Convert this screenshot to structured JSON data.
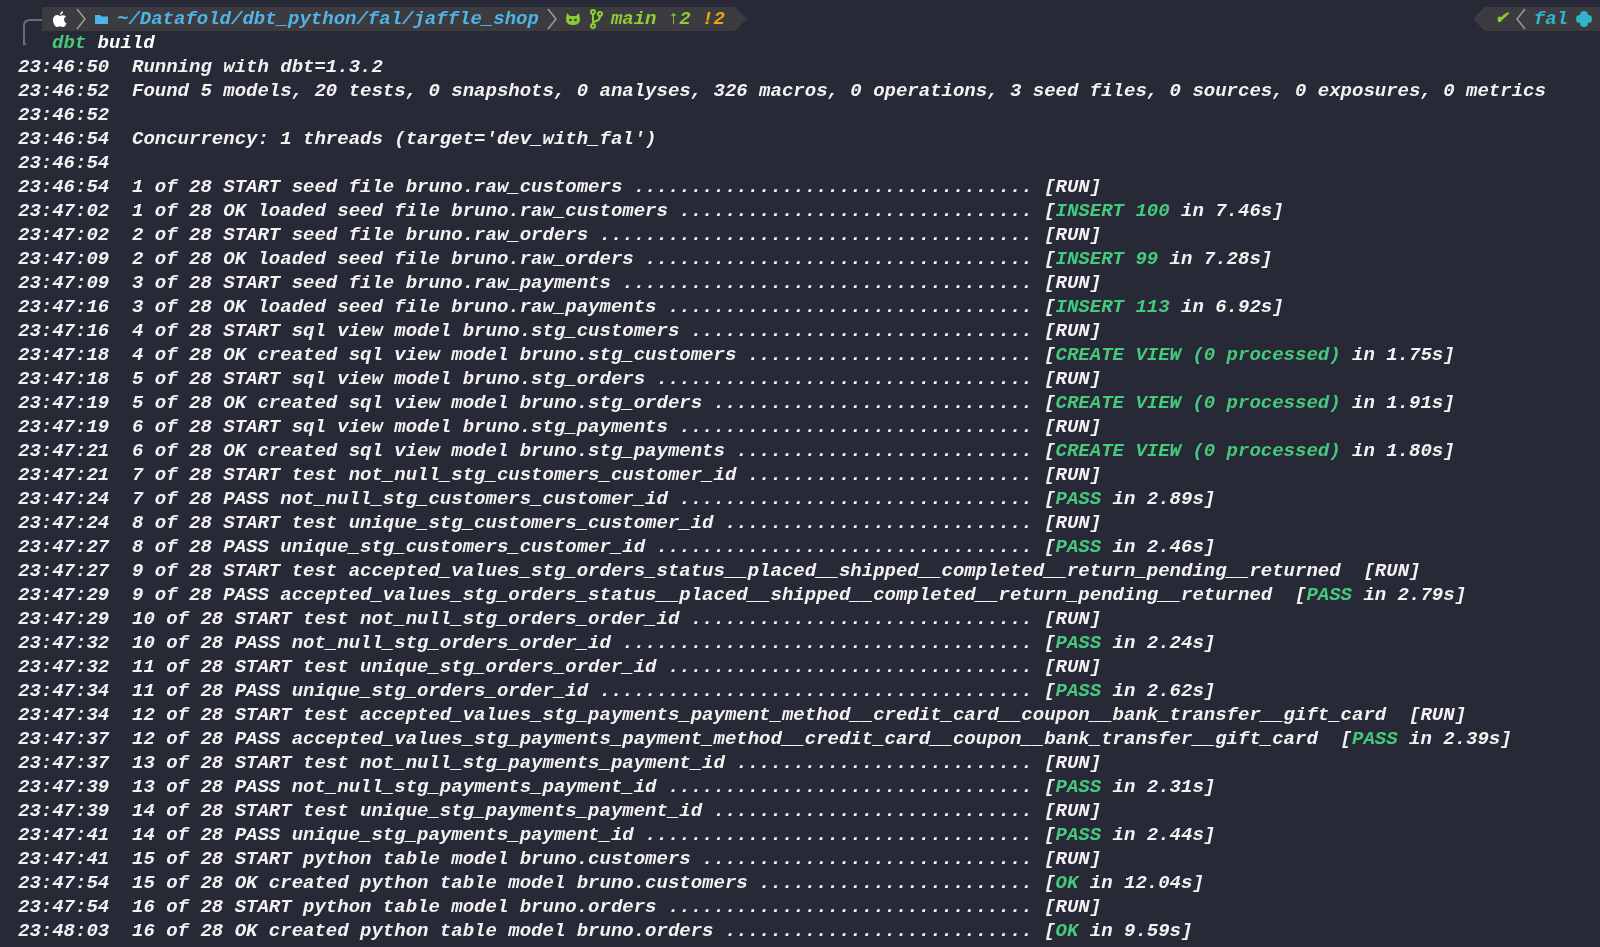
{
  "prompt": {
    "path": "~/Datafold/dbt_python/fal/jaffle_shop",
    "branch": "main",
    "ahead": "↑2",
    "modified": "!2",
    "status_mark": "✔",
    "env": "fal"
  },
  "command": {
    "program": "dbt",
    "args": "build"
  },
  "lines": [
    {
      "time": "23:46:50",
      "message": "Running with dbt=1.3.2"
    },
    {
      "time": "23:46:52",
      "message": "Found 5 models, 20 tests, 0 snapshots, 0 analyses, 326 macros, 0 operations, 3 seed files, 0 sources, 0 exposures, 0 metrics"
    },
    {
      "time": "23:46:52"
    },
    {
      "time": "23:46:54",
      "message": "Concurrency: 1 threads (target='dev_with_fal')"
    },
    {
      "time": "23:46:54"
    },
    {
      "time": "23:46:54",
      "message": "1 of 28 START seed file bruno.raw_customers",
      "dots": "...................................",
      "status": [
        {
          "text": "[RUN]",
          "kind": "plain"
        }
      ]
    },
    {
      "time": "23:47:02",
      "message": "1 of 28 OK loaded seed file bruno.raw_customers",
      "dots": "...............................",
      "status": [
        {
          "text": "[",
          "kind": "plain"
        },
        {
          "text": "INSERT 100",
          "kind": "success"
        },
        {
          "text": " in 7.46s]",
          "kind": "plain"
        }
      ]
    },
    {
      "time": "23:47:02",
      "message": "2 of 28 START seed file bruno.raw_orders",
      "dots": "......................................",
      "status": [
        {
          "text": "[RUN]",
          "kind": "plain"
        }
      ]
    },
    {
      "time": "23:47:09",
      "message": "2 of 28 OK loaded seed file bruno.raw_orders",
      "dots": "..................................",
      "status": [
        {
          "text": "[",
          "kind": "plain"
        },
        {
          "text": "INSERT 99",
          "kind": "success"
        },
        {
          "text": " in 7.28s]",
          "kind": "plain"
        }
      ]
    },
    {
      "time": "23:47:09",
      "message": "3 of 28 START seed file bruno.raw_payments",
      "dots": "....................................",
      "status": [
        {
          "text": "[RUN]",
          "kind": "plain"
        }
      ]
    },
    {
      "time": "23:47:16",
      "message": "3 of 28 OK loaded seed file bruno.raw_payments",
      "dots": "................................",
      "status": [
        {
          "text": "[",
          "kind": "plain"
        },
        {
          "text": "INSERT 113",
          "kind": "success"
        },
        {
          "text": " in 6.92s]",
          "kind": "plain"
        }
      ]
    },
    {
      "time": "23:47:16",
      "message": "4 of 28 START sql view model bruno.stg_customers",
      "dots": "..............................",
      "status": [
        {
          "text": "[RUN]",
          "kind": "plain"
        }
      ]
    },
    {
      "time": "23:47:18",
      "message": "4 of 28 OK created sql view model bruno.stg_customers",
      "dots": ".........................",
      "status": [
        {
          "text": "[",
          "kind": "plain"
        },
        {
          "text": "CREATE VIEW (0 processed)",
          "kind": "success"
        },
        {
          "text": " in 1.75s]",
          "kind": "plain"
        }
      ]
    },
    {
      "time": "23:47:18",
      "message": "5 of 28 START sql view model bruno.stg_orders",
      "dots": ".................................",
      "status": [
        {
          "text": "[RUN]",
          "kind": "plain"
        }
      ]
    },
    {
      "time": "23:47:19",
      "message": "5 of 28 OK created sql view model bruno.stg_orders",
      "dots": "............................",
      "status": [
        {
          "text": "[",
          "kind": "plain"
        },
        {
          "text": "CREATE VIEW (0 processed)",
          "kind": "success"
        },
        {
          "text": " in 1.91s]",
          "kind": "plain"
        }
      ]
    },
    {
      "time": "23:47:19",
      "message": "6 of 28 START sql view model bruno.stg_payments",
      "dots": "...............................",
      "status": [
        {
          "text": "[RUN]",
          "kind": "plain"
        }
      ]
    },
    {
      "time": "23:47:21",
      "message": "6 of 28 OK created sql view model bruno.stg_payments",
      "dots": "..........................",
      "status": [
        {
          "text": "[",
          "kind": "plain"
        },
        {
          "text": "CREATE VIEW (0 processed)",
          "kind": "success"
        },
        {
          "text": " in 1.80s]",
          "kind": "plain"
        }
      ]
    },
    {
      "time": "23:47:21",
      "message": "7 of 28 START test not_null_stg_customers_customer_id",
      "dots": ".........................",
      "status": [
        {
          "text": "[RUN]",
          "kind": "plain"
        }
      ]
    },
    {
      "time": "23:47:24",
      "message": "7 of 28 PASS not_null_stg_customers_customer_id",
      "dots": "...............................",
      "status": [
        {
          "text": "[",
          "kind": "plain"
        },
        {
          "text": "PASS",
          "kind": "success"
        },
        {
          "text": " in 2.89s]",
          "kind": "plain"
        }
      ]
    },
    {
      "time": "23:47:24",
      "message": "8 of 28 START test unique_stg_customers_customer_id",
      "dots": "...........................",
      "status": [
        {
          "text": "[RUN]",
          "kind": "plain"
        }
      ]
    },
    {
      "time": "23:47:27",
      "message": "8 of 28 PASS unique_stg_customers_customer_id",
      "dots": ".................................",
      "status": [
        {
          "text": "[",
          "kind": "plain"
        },
        {
          "text": "PASS",
          "kind": "success"
        },
        {
          "text": " in 2.46s]",
          "kind": "plain"
        }
      ]
    },
    {
      "time": "23:47:27",
      "message": "9 of 28 START test accepted_values_stg_orders_status__placed__shipped__completed__return_pending__returned",
      "status": [
        {
          "text": "[RUN]",
          "kind": "plain"
        }
      ]
    },
    {
      "time": "23:47:29",
      "message": "9 of 28 PASS accepted_values_stg_orders_status__placed__shipped__completed__return_pending__returned",
      "status": [
        {
          "text": "[",
          "kind": "plain"
        },
        {
          "text": "PASS",
          "kind": "success"
        },
        {
          "text": " in 2.79s]",
          "kind": "plain"
        }
      ]
    },
    {
      "time": "23:47:29",
      "message": "10 of 28 START test not_null_stg_orders_order_id",
      "dots": "..............................",
      "status": [
        {
          "text": "[RUN]",
          "kind": "plain"
        }
      ]
    },
    {
      "time": "23:47:32",
      "message": "10 of 28 PASS not_null_stg_orders_order_id",
      "dots": "....................................",
      "status": [
        {
          "text": "[",
          "kind": "plain"
        },
        {
          "text": "PASS",
          "kind": "success"
        },
        {
          "text": " in 2.24s]",
          "kind": "plain"
        }
      ]
    },
    {
      "time": "23:47:32",
      "message": "11 of 28 START test unique_stg_orders_order_id",
      "dots": "................................",
      "status": [
        {
          "text": "[RUN]",
          "kind": "plain"
        }
      ]
    },
    {
      "time": "23:47:34",
      "message": "11 of 28 PASS unique_stg_orders_order_id",
      "dots": "......................................",
      "status": [
        {
          "text": "[",
          "kind": "plain"
        },
        {
          "text": "PASS",
          "kind": "success"
        },
        {
          "text": " in 2.62s]",
          "kind": "plain"
        }
      ]
    },
    {
      "time": "23:47:34",
      "message": "12 of 28 START test accepted_values_stg_payments_payment_method__credit_card__coupon__bank_transfer__gift_card",
      "status": [
        {
          "text": "[RUN]",
          "kind": "plain"
        }
      ]
    },
    {
      "time": "23:47:37",
      "message": "12 of 28 PASS accepted_values_stg_payments_payment_method__credit_card__coupon__bank_transfer__gift_card",
      "status": [
        {
          "text": "[",
          "kind": "plain"
        },
        {
          "text": "PASS",
          "kind": "success"
        },
        {
          "text": " in 2.39s]",
          "kind": "plain"
        }
      ]
    },
    {
      "time": "23:47:37",
      "message": "13 of 28 START test not_null_stg_payments_payment_id",
      "dots": "..........................",
      "status": [
        {
          "text": "[RUN]",
          "kind": "plain"
        }
      ]
    },
    {
      "time": "23:47:39",
      "message": "13 of 28 PASS not_null_stg_payments_payment_id",
      "dots": "................................",
      "status": [
        {
          "text": "[",
          "kind": "plain"
        },
        {
          "text": "PASS",
          "kind": "success"
        },
        {
          "text": " in 2.31s]",
          "kind": "plain"
        }
      ]
    },
    {
      "time": "23:47:39",
      "message": "14 of 28 START test unique_stg_payments_payment_id",
      "dots": "............................",
      "status": [
        {
          "text": "[RUN]",
          "kind": "plain"
        }
      ]
    },
    {
      "time": "23:47:41",
      "message": "14 of 28 PASS unique_stg_payments_payment_id",
      "dots": "..................................",
      "status": [
        {
          "text": "[",
          "kind": "plain"
        },
        {
          "text": "PASS",
          "kind": "success"
        },
        {
          "text": " in 2.44s]",
          "kind": "plain"
        }
      ]
    },
    {
      "time": "23:47:41",
      "message": "15 of 28 START python table model bruno.customers",
      "dots": ".............................",
      "status": [
        {
          "text": "[RUN]",
          "kind": "plain"
        }
      ]
    },
    {
      "time": "23:47:54",
      "message": "15 of 28 OK created python table model bruno.customers",
      "dots": "........................",
      "status": [
        {
          "text": "[",
          "kind": "plain"
        },
        {
          "text": "OK",
          "kind": "success"
        },
        {
          "text": " in 12.04s]",
          "kind": "plain"
        }
      ]
    },
    {
      "time": "23:47:54",
      "message": "16 of 28 START python table model bruno.orders",
      "dots": "................................",
      "status": [
        {
          "text": "[RUN]",
          "kind": "plain"
        }
      ]
    },
    {
      "time": "23:48:03",
      "message": "16 of 28 OK created python table model bruno.orders",
      "dots": "...........................",
      "status": [
        {
          "text": "[",
          "kind": "plain"
        },
        {
          "text": "OK",
          "kind": "success"
        },
        {
          "text": " in 9.59s]",
          "kind": "plain"
        }
      ]
    }
  ]
}
